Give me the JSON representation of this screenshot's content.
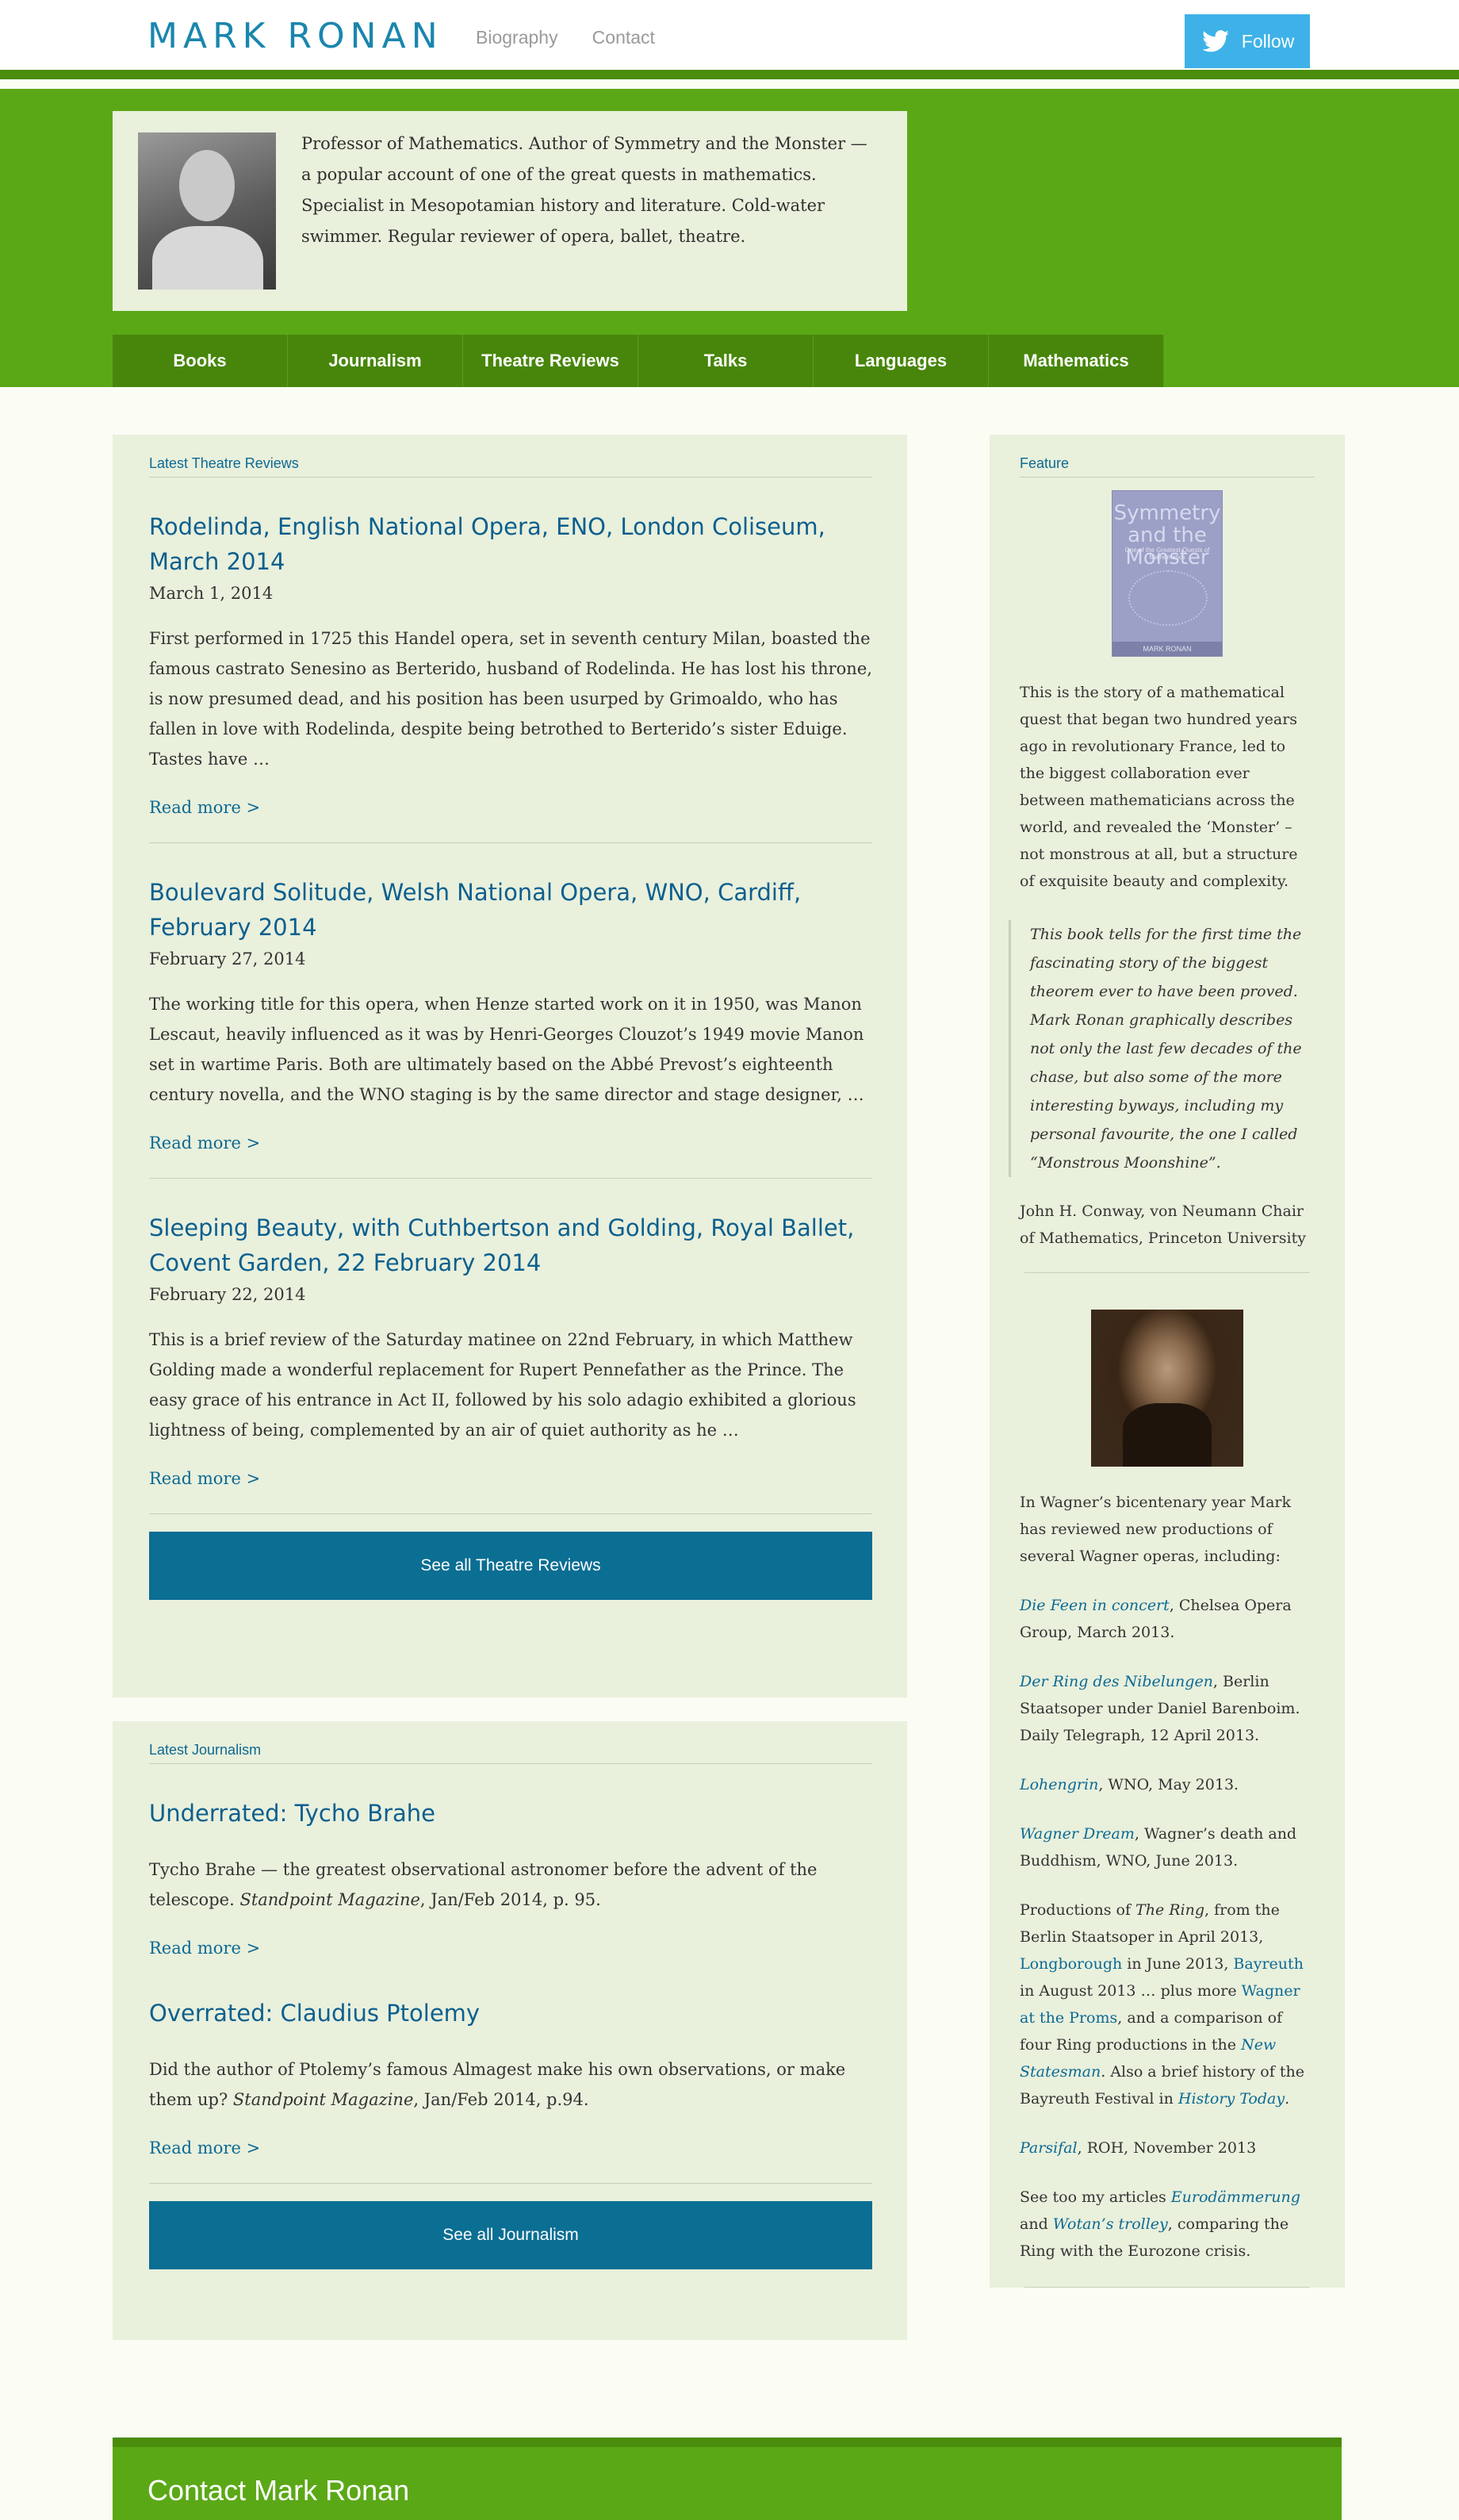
{
  "header": {
    "logo": "MARK RONAN",
    "nav": [
      "Biography",
      "Contact"
    ],
    "follow_label": "Follow"
  },
  "intro": {
    "text": "Professor of Mathematics. Author of Symmetry and the Monster — a popular account of one of the great quests in mathematics. Specialist in Mesopotamian history and literature. Cold-water swimmer. Regular reviewer of opera, ballet, theatre."
  },
  "main_nav": [
    "Books",
    "Journalism",
    "Theatre Reviews",
    "Talks",
    "Languages",
    "Mathematics"
  ],
  "theatre": {
    "heading": "Latest Theatre Reviews",
    "items": [
      {
        "title": "Rodelinda, English National Opera, ENO, London Coliseum, March 2014",
        "date": "March 1, 2014",
        "body": "First performed in 1725 this Handel opera, set in seventh century Milan, boasted the famous castrato Senesino as Berterido, husband of Rodelinda. He has lost his throne, is now presumed dead, and his position has been usurped by Grimoaldo, who has fallen in love with Rodelinda, despite being betrothed to Berterido’s sister Eduige. Tastes have …",
        "more": "Read more >"
      },
      {
        "title": "Boulevard Solitude, Welsh National Opera, WNO, Cardiff, February 2014",
        "date": "February 27, 2014",
        "body": "The working title for this opera, when Henze started work on it in 1950, was Manon Lescaut, heavily influenced as it was by Henri-Georges Clouzot’s 1949 movie Manon set in wartime Paris. Both are ultimately based on the Abbé Prevost’s eighteenth century novella, and the WNO staging is by the same director and stage designer, …",
        "more": "Read more >"
      },
      {
        "title": "Sleeping Beauty, with Cuthbertson and Golding, Royal Ballet, Covent Garden, 22 February 2014",
        "date": "February 22, 2014",
        "body": "This is a brief review of the Saturday matinee on 22nd February, in which Matthew Golding made a wonderful replacement for Rupert Pennefather as the Prince. The easy grace of his entrance in Act II, followed by his solo adagio exhibited a glorious lightness of being, complemented by an air of quiet authority as he …",
        "more": "Read more >"
      }
    ],
    "see_all": "See all Theatre Reviews"
  },
  "journalism": {
    "heading": "Latest Journalism",
    "items": [
      {
        "title": "Underrated: Tycho Brahe",
        "body": "Tycho Brahe — the greatest observational astronomer before the advent of the telescope.",
        "pub": "Standpoint Magazine",
        "ref": ", Jan/Feb 2014, p. 95.",
        "more": "Read more >"
      },
      {
        "title": "Overrated: Claudius Ptolemy",
        "body": "Did the author of Ptolemy’s famous Almagest make his own observations, or make them up?",
        "pub": "Standpoint Magazine",
        "ref": ", Jan/Feb 2014, p.94.",
        "more": "Read more >"
      }
    ],
    "see_all": "See all Journalism"
  },
  "feature": {
    "heading": "Feature",
    "book_title": "Symmetry and the Monster",
    "book_sub": "One of the Greatest Quests of Mathematics",
    "book_author": "MARK RONAN",
    "desc": "This is the story of a mathematical quest that began two hundred years ago in revolutionary France, led to the biggest collaboration ever between mathematicians across the world, and revealed the ‘Monster’ – not monstrous at all, but a structure of exquisite beauty and complexity.",
    "quote": "This book tells for the first time the fascinating story of the biggest theorem ever to have been proved. Mark Ronan graphically describes not only the last few decades of the chase, but also some of the more interesting byways, including my personal favourite, the one I called “Monstrous Moonshine”.",
    "attribution": "John H. Conway, von Neumann Chair of Mathematics, Princeton University",
    "wagner_intro": "In Wagner’s bicentenary year Mark has reviewed new productions of several Wagner operas, including:",
    "w1_link": "Die Feen in concert",
    "w1_text": ", Chelsea Opera Group, March 2013.",
    "w2_link": "Der Ring des Nibelungen",
    "w2_text": ", Berlin Staatsoper under Daniel Barenboim. Daily Telegraph,  12 April 2013.",
    "w3_link": "Lohengrin",
    "w3_text": ", WNO, May 2013.",
    "w4_link": "Wagner Dream",
    "w4_text": ",  Wagner’s death and Buddhism, WNO, June 2013.",
    "w5_a": "Productions of ",
    "w5_ring": "The Ring",
    "w5_b": ", from the Berlin Staatsoper in April 2013,  ",
    "w5_l1": "Longborough",
    "w5_c": " in June 2013,  ",
    "w5_l2": "Bayreuth",
    "w5_d": " in August 2013 … plus more ",
    "w5_l3": "Wagner at the Proms",
    "w5_e": ", and a comparison of four Ring productions in the ",
    "w5_l4": "New Statesman",
    "w5_f": ". Also a brief history of the Bayreuth Festival in ",
    "w5_l5": "History Today",
    "w5_g": ".",
    "w6_link": "Parsifal",
    "w6_text": ", ROH, November 2013",
    "w7_a": "See too my articles ",
    "w7_l1": "Eurodämmerung",
    "w7_b": " and ",
    "w7_l2": "Wotan’s trolley",
    "w7_c": ", comparing the Ring with the Eurozone crisis."
  },
  "footer": {
    "heading": "Contact Mark Ronan"
  },
  "colors": {
    "green": "#5ba817",
    "dark_green": "#47860a",
    "panel": "#e9f0dc",
    "link": "#0c6a94",
    "button": "#0b6e93",
    "twitter": "#3eb2e8"
  }
}
